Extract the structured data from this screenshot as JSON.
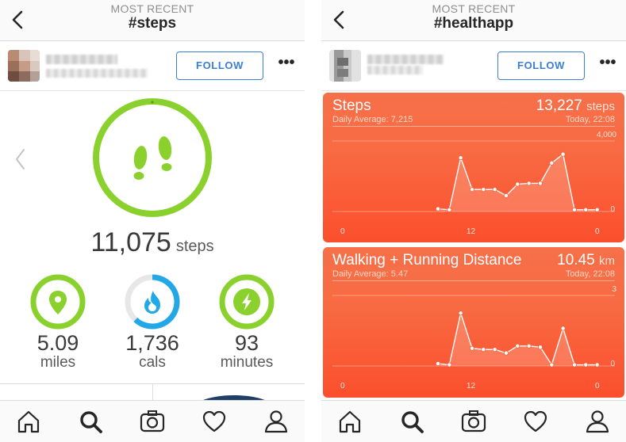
{
  "left": {
    "header": {
      "subtitle": "MOST RECENT",
      "title": "#steps"
    },
    "follow_label": "FOLLOW",
    "more_label": "•••",
    "steps": {
      "value": "11,075",
      "unit": "steps"
    },
    "stats": [
      {
        "value": "5.09",
        "unit": "miles",
        "icon": "location-pin-icon",
        "fill": 1.0
      },
      {
        "value": "1,736",
        "unit": "cals",
        "icon": "flame-icon",
        "fill": 0.62
      },
      {
        "value": "93",
        "unit": "minutes",
        "icon": "lightning-icon",
        "fill": 1.0
      }
    ],
    "colors": {
      "green": "#8ad12e",
      "blue": "#22a8e6",
      "track": "#e7e7e7"
    }
  },
  "right": {
    "header": {
      "subtitle": "MOST RECENT",
      "title": "#healthapp"
    },
    "follow_label": "FOLLOW",
    "more_label": "•••",
    "cards": [
      {
        "title": "Steps",
        "value": "13,227",
        "unit": "steps",
        "average": "Daily Average: 7,215",
        "time": "Today, 22:08",
        "max_label": "4,000",
        "zero_label": "0",
        "x_labels": [
          "0",
          "12",
          "0"
        ],
        "chart_data": {
          "type": "line",
          "x": [
            9,
            10,
            11,
            12,
            13,
            14,
            15,
            16,
            17,
            18,
            19,
            20,
            21,
            22,
            23
          ],
          "y": [
            150,
            100,
            3050,
            1250,
            1250,
            1250,
            900,
            1550,
            1600,
            1600,
            2750,
            3250,
            100,
            100,
            100
          ],
          "ylim": [
            0,
            4000
          ],
          "xlim": [
            0,
            24
          ]
        }
      },
      {
        "title": "Walking + Running Distance",
        "value": "10.45",
        "unit": "km",
        "average": "Daily Average: 5.47",
        "time": "Today, 22:08",
        "max_label": "3",
        "zero_label": "0",
        "x_labels": [
          "0",
          "12",
          "0"
        ],
        "chart_data": {
          "type": "line",
          "x": [
            9,
            10,
            11,
            12,
            13,
            14,
            15,
            16,
            17,
            18,
            19,
            20,
            21,
            22,
            23
          ],
          "y": [
            0.1,
            0.05,
            2.25,
            0.75,
            0.7,
            0.7,
            0.55,
            0.85,
            0.85,
            0.8,
            0.05,
            1.6,
            0.05,
            0.05,
            0.05
          ],
          "ylim": [
            0,
            3
          ],
          "xlim": [
            0,
            24
          ]
        }
      }
    ],
    "colors": {
      "card_top": "#f6704a",
      "card_bottom": "#fb4f2d",
      "line": "#ffffff"
    }
  },
  "tabbar": [
    {
      "icon": "home-icon"
    },
    {
      "icon": "search-icon"
    },
    {
      "icon": "camera-icon"
    },
    {
      "icon": "heart-icon"
    },
    {
      "icon": "profile-icon"
    }
  ]
}
